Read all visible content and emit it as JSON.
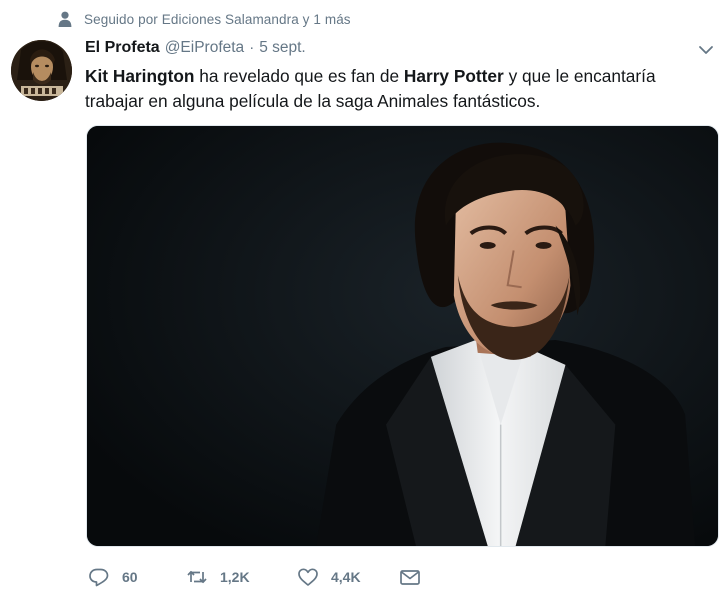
{
  "context": {
    "text": "Seguido por Ediciones Salamandra y 1 más",
    "icon": "person-icon"
  },
  "tweet": {
    "author_name": "El Profeta",
    "handle": "@EiProfeta",
    "separator": "·",
    "date": "5 sept.",
    "text_parts": {
      "p1": "Kit Harington",
      "p2": " ha revelado que es fan de ",
      "p3": "Harry Potter",
      "p4": " y que le encantaría trabajar en alguna película de la saga Animales fantásticos."
    }
  },
  "actions": {
    "reply_count": "60",
    "retweet_count": "1,2K",
    "like_count": "4,4K"
  },
  "colors": {
    "text_primary": "#14171a",
    "text_secondary": "#657786",
    "border": "#e1e8ed"
  }
}
